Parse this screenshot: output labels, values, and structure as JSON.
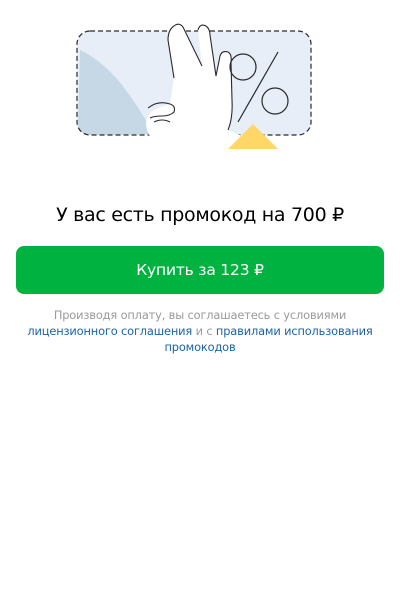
{
  "promo": {
    "title": "У вас есть промокод на 700 ₽",
    "buy_label": "Купить за 123 ₽"
  },
  "terms": {
    "prefix": "Производя оплату, вы соглашаетесь с условиями ",
    "license_link": "лицензионного соглашения",
    "middle": " и с ",
    "promo_rules_link": "правилами использования промокодов"
  },
  "colors": {
    "accent": "#00b341",
    "link": "#1a63a8",
    "muted_text": "#9a9a9a",
    "coupon_fill": "#e8eef8",
    "coupon_shade": "#c6d8e6",
    "highlight": "#ffe17a"
  },
  "illustration": {
    "icon": "hand-holding-discount-coupon-icon"
  }
}
